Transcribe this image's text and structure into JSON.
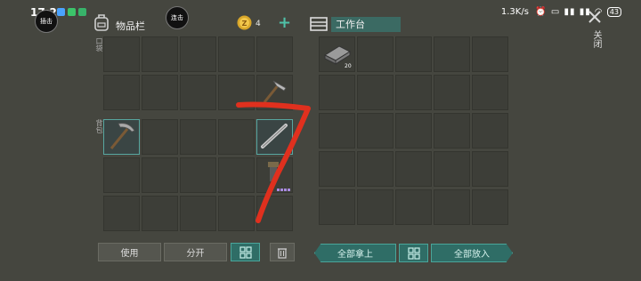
{
  "status": {
    "time": "17:28",
    "speed": "1.3K/s",
    "battery": "43"
  },
  "overlay": {
    "float_btn_1": "插击",
    "float_btn_2": "连击"
  },
  "inventory": {
    "title": "物品栏",
    "coin_count": "4",
    "label_pocket": "口袋",
    "label_backpack": "背包"
  },
  "workbench": {
    "title": "工作台",
    "close_label": "关闭",
    "item_count": "20"
  },
  "buttons": {
    "use": "使用",
    "split": "分开",
    "take_all": "全部拿上",
    "put_all": "全部放入"
  },
  "colors": {
    "background": "#45463f",
    "slot": "#3d3e38",
    "accent_teal": "#4aa59a",
    "annotation_red": "#e0301e"
  },
  "icons": [
    "backpack-icon",
    "coin-icon",
    "plus-icon",
    "chest-icon",
    "close-icon",
    "grid-icon",
    "trash-icon",
    "pickaxe-icon",
    "hammer-icon",
    "crowbar-icon",
    "metal-bar-icon"
  ]
}
